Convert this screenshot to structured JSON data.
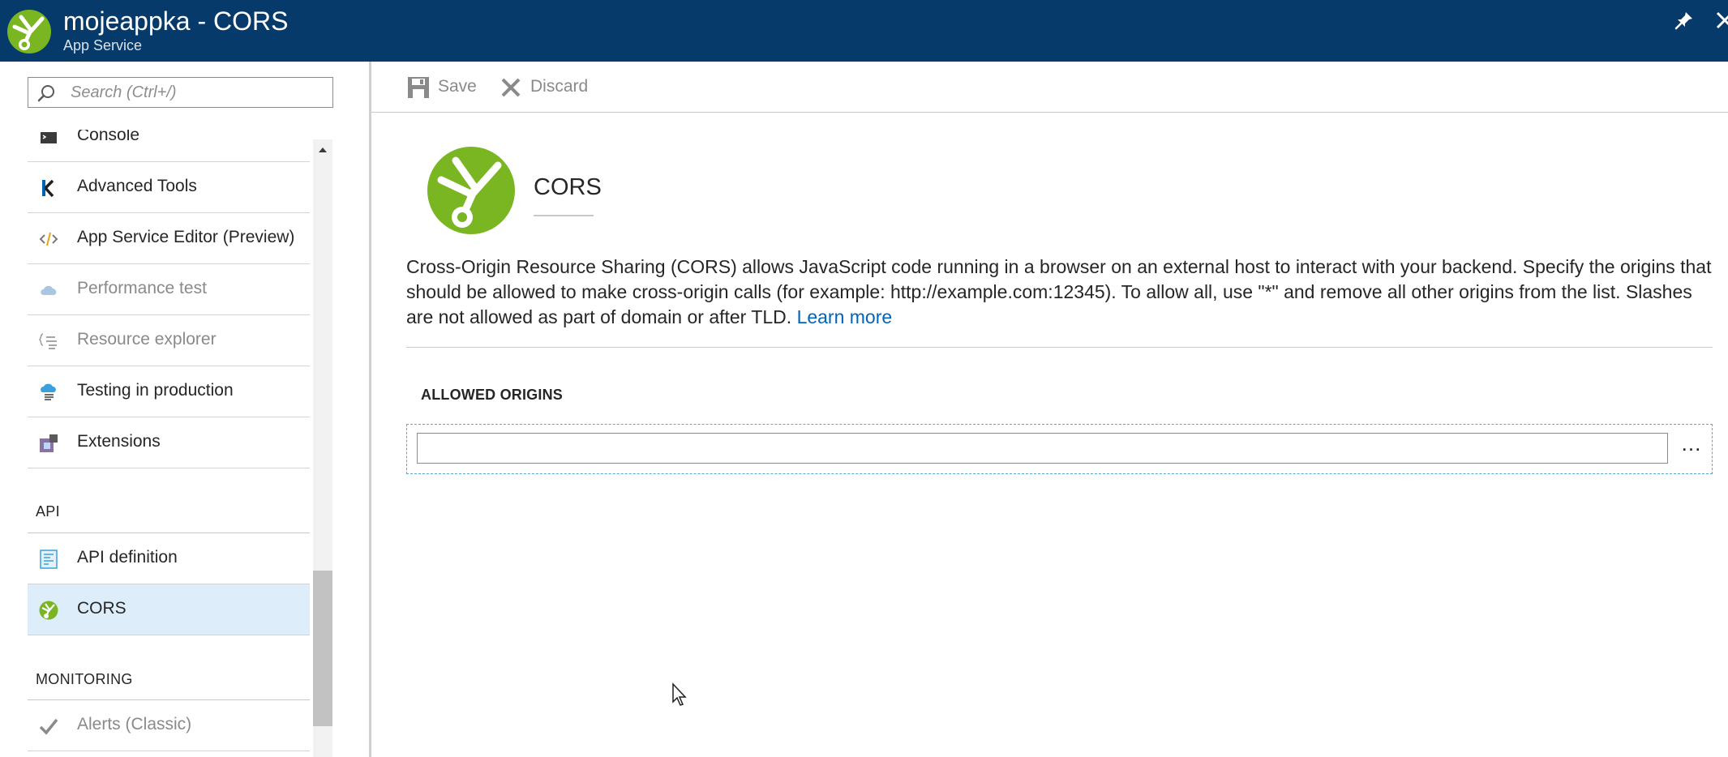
{
  "header": {
    "title": "mojeappka - CORS",
    "subtitle": "App Service",
    "icons": {
      "logo": "app-service-cors-icon",
      "pin": "pin-icon",
      "close": "close-icon"
    },
    "colors": {
      "background": "#053a6b",
      "text": "#ffffff",
      "logo_green": "#7ab522"
    }
  },
  "sidebar": {
    "search": {
      "placeholder": "Search (Ctrl+/)",
      "value": ""
    },
    "items": [
      {
        "label": "Console",
        "icon": "console-icon",
        "disabled": false
      },
      {
        "label": "Advanced Tools",
        "icon": "kudu-icon",
        "disabled": false
      },
      {
        "label": "App Service Editor (Preview)",
        "icon": "code-editor-icon",
        "disabled": false
      },
      {
        "label": "Performance test",
        "icon": "cloud-icon",
        "disabled": true
      },
      {
        "label": "Resource explorer",
        "icon": "resource-explorer-icon",
        "disabled": true
      },
      {
        "label": "Testing in production",
        "icon": "testing-in-production-icon",
        "disabled": false
      },
      {
        "label": "Extensions",
        "icon": "extensions-icon",
        "disabled": false
      }
    ],
    "sections": {
      "api": {
        "title": "API",
        "items": [
          {
            "label": "API definition",
            "icon": "api-definition-icon",
            "selected": false
          },
          {
            "label": "CORS",
            "icon": "cors-icon",
            "selected": true
          }
        ]
      },
      "monitoring": {
        "title": "MONITORING",
        "items": [
          {
            "label": "Alerts (Classic)",
            "icon": "checkmark-icon",
            "disabled": true
          }
        ]
      }
    },
    "colors": {
      "selected_bg": "#ddedfa"
    }
  },
  "toolbar": {
    "save_label": "Save",
    "discard_label": "Discard",
    "save_icon": "save-icon",
    "discard_icon": "discard-icon"
  },
  "content": {
    "title": "CORS",
    "description": "Cross-Origin Resource Sharing (CORS) allows JavaScript code running in a browser on an external host to interact with your backend. Specify the origins that should be allowed to make cross-origin calls (for example: http://example.com:12345). To allow all, use \"*\" and remove all other origins from the list. Slashes are not allowed as part of domain or after TLD.",
    "learn_more": "Learn more",
    "allowed_origins": {
      "header": "ALLOWED ORIGINS",
      "rows": [
        {
          "value": ""
        }
      ],
      "more_label": "..."
    },
    "colors": {
      "link": "#0163bd"
    }
  }
}
